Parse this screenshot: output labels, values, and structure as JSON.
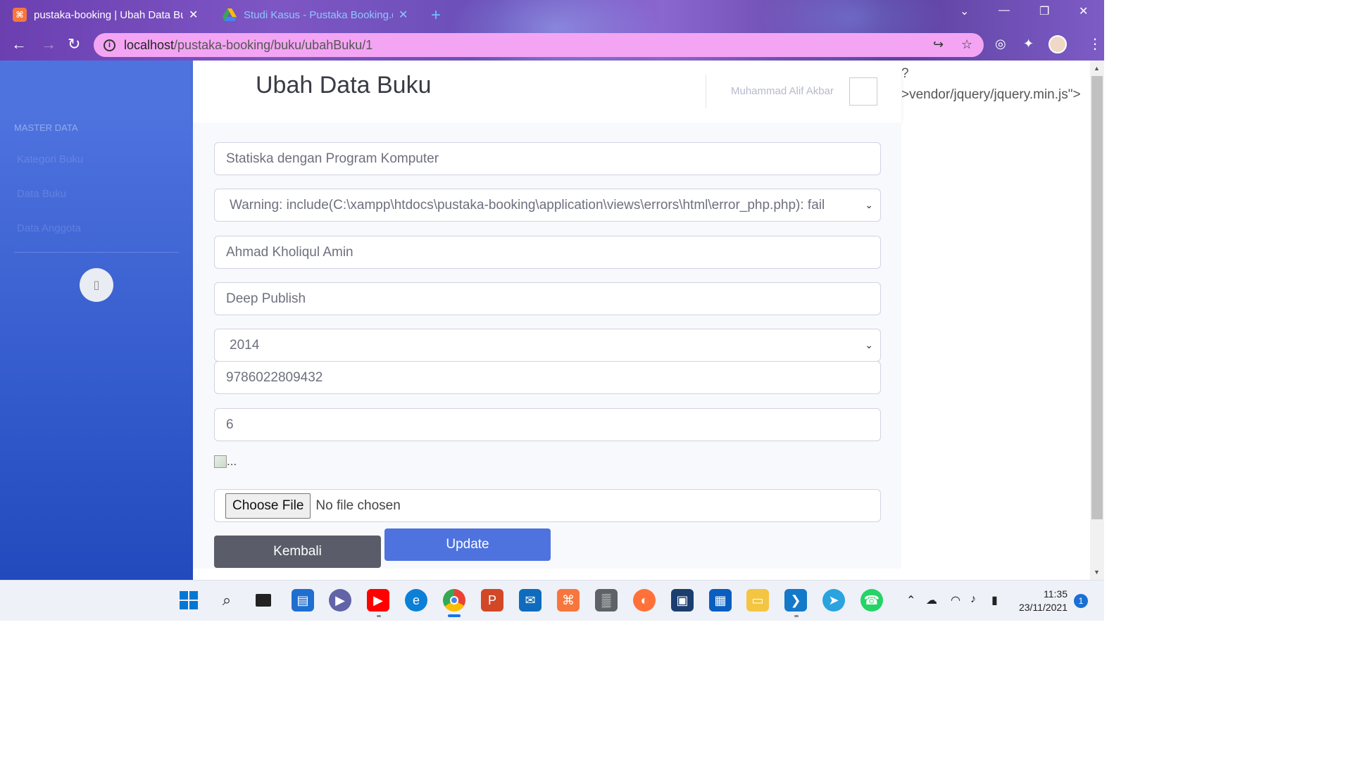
{
  "browser": {
    "tabs": [
      {
        "title": "pustaka-booking | Ubah Data Bu",
        "active": true,
        "favicon": "xampp-icon"
      },
      {
        "title": "Studi Kasus - Pustaka Booking.d",
        "active": false,
        "favicon": "google-drive-icon"
      }
    ],
    "new_tab": "+",
    "url_host": "localhost",
    "url_path": "/pustaka-booking/buku/ubahBuku/1"
  },
  "sidebar": {
    "heading": "MASTER DATA",
    "items": [
      {
        "label": "Kategori Buku"
      },
      {
        "label": "Data Buku"
      },
      {
        "label": "Data Anggota"
      }
    ],
    "toggle_glyph": "▯"
  },
  "topbar": {
    "title": "Ubah Data Buku",
    "user_name": "Muhammad Alif Akbar"
  },
  "form": {
    "judul_buku": "Statiska dengan Program Komputer",
    "kategori_select": "Warning: include(C:\\xampp\\htdocs\\pustaka-booking\\application\\views\\errors\\html\\error_php.php): fail",
    "pengarang": "Ahmad Kholiqul Amin",
    "penerbit": "Deep Publish",
    "tahun_select": "2014",
    "isbn": "9786022809432",
    "stok": "6",
    "image_alt": "...",
    "choose_file_label": "Choose File",
    "no_file_text": "No file chosen",
    "back_button": "Kembali",
    "update_button": "Update"
  },
  "php_leak": {
    "line1": "?",
    "line2": ">vendor/jquery/jquery.min.js\">"
  },
  "taskbar": {
    "time": "11:35",
    "date": "23/11/2021",
    "notification_count": "1"
  },
  "colors": {
    "primary": "#4e73df",
    "secondary": "#5a5c69",
    "sidebar_gradient_end": "#224abe",
    "omnibox": "#f3a5f3"
  }
}
